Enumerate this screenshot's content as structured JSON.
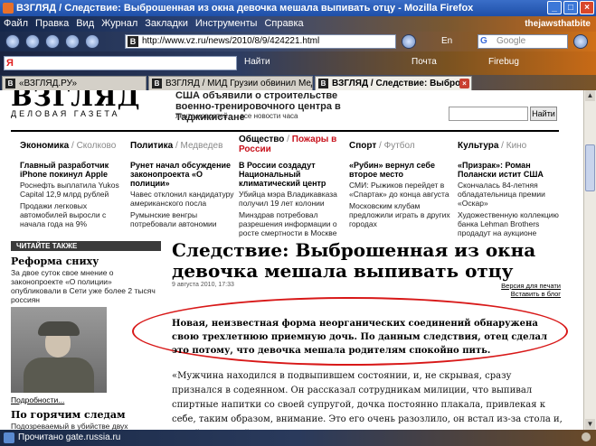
{
  "window": {
    "title": "ВЗГЛЯД / Следствие: Выброшенная из окна девочка мешала выпивать отцу - Mozilla Firefox",
    "min": "_",
    "max": "□",
    "close": "×"
  },
  "menu": [
    "Файл",
    "Правка",
    "Вид",
    "Журнал",
    "Закладки",
    "Инструменты",
    "Справка"
  ],
  "menu_brand": "thejawsthatbite",
  "nav": {
    "url": "http://www.vz.ru/news/2010/8/9/424221.html",
    "url_favicon": "B",
    "lang": "En",
    "search_engine": "G",
    "search_placeholder": "Google"
  },
  "yandex": {
    "logo": "Я",
    "find": "Найти",
    "mail": "Почта",
    "firebug": "Firebug"
  },
  "tabs": [
    {
      "label": "«ВЗГЛЯД.РУ»",
      "active": false
    },
    {
      "label": "ВЗГЛЯД / МИД Грузии обвинил Медв...",
      "active": false
    },
    {
      "label": "ВЗГЛЯД / Следствие: Выбро...",
      "active": true
    }
  ],
  "tab_close": "×",
  "site": {
    "logo": "ВЗГЛЯД",
    "logo_sub": "ДЕЛОВАЯ ГАЗЕТА",
    "top_headline": "США объявили о строительстве военно-тренировочного центра в Таджикистане",
    "top_links": [
      "лента новостей",
      "все новости часа"
    ],
    "search_button": "Найти"
  },
  "rubrics": [
    {
      "main": "Экономика",
      "sep": " / ",
      "sub": "Сколково"
    },
    {
      "main": "Политика",
      "sep": " / ",
      "sub": "Медведев"
    },
    {
      "main": "Общество",
      "sep": " / ",
      "sub": "Пожары в России"
    },
    {
      "main": "Спорт",
      "sep": " / ",
      "sub": "Футбол"
    },
    {
      "main": "Культура",
      "sep": " / ",
      "sub": "Кино"
    }
  ],
  "news": [
    {
      "h": "Главный разработчик iPhone покинул Apple",
      "items": [
        "Роснефть выплатила Yukos Capital 12,9 млрд рублей",
        "Продажи легковых автомобилей выросли с начала года на 9%"
      ]
    },
    {
      "h": "Рунет начал обсуждение законопроекта «О полиции»",
      "items": [
        "Чавес отклонил кандидатуру американского посла",
        "Румынские венгры потребовали автономии"
      ]
    },
    {
      "h": "В России создадут Национальный климатический центр",
      "items": [
        "Убийца мэра Владикавказа получил 19 лет колонии",
        "Минздрав потребовал разрешения информации о росте смертности в Москве"
      ]
    },
    {
      "h": "«Рубин» вернул себе второе место",
      "items": [
        "СМИ: Рыжиков перейдет в «Спартак» до конца августа",
        "Московским клубам предложили играть в других городах"
      ]
    },
    {
      "h": "«Призрак»: Роман Полански истит США",
      "items": [
        "Скончалась 84-летняя обладательница премии «Оскар»",
        "Художественную коллекцию банка Lehman Brothers продадут на аукционе"
      ]
    }
  ],
  "sidebar": {
    "header": "ЧИТАЙТЕ ТАКЖЕ",
    "item1_title": "Реформа сниху",
    "item1_text": "За двое суток свое мнение о законопроекте «О полиции» опубликовали в Сети уже более 2 тысяч россиян",
    "more": "Подробности...",
    "item2_title": "По горячим следам",
    "item2_text": "Подозреваемый в убийстве двух милиционеров не успел скрыться"
  },
  "article": {
    "title": "Следствие: Выброшенная из окна девочка мешала выпивать отцу",
    "date": "9 августа 2010, 17:33",
    "print": "Версия для печати",
    "blog": "Вставить в блог",
    "lead": "Новая, неизвестная форма неорганических соединений обнаружена свою трехлетнюю приемную дочь. По данным следствия, отец сделал это потому, что девочка мешала родителям спокойно пить.",
    "body": "«Мужчина находился в подвыпившем состоянии, и, не скрывая, сразу признался в содеянном. Он рассказал сотрудникам милиции, что выпивал спиртные напитки со своей супругой, дочка постоянно плакала, привлекая к себе, таким образом, внимание. Это его очень разозлило, он встал из-за стола и, подойдя к своей дочке, поднял ее на"
  },
  "status": "Прочитано gate.russia.ru",
  "colors": {
    "accent_red": "#d81818",
    "title_blue": "#1e4fa8"
  }
}
